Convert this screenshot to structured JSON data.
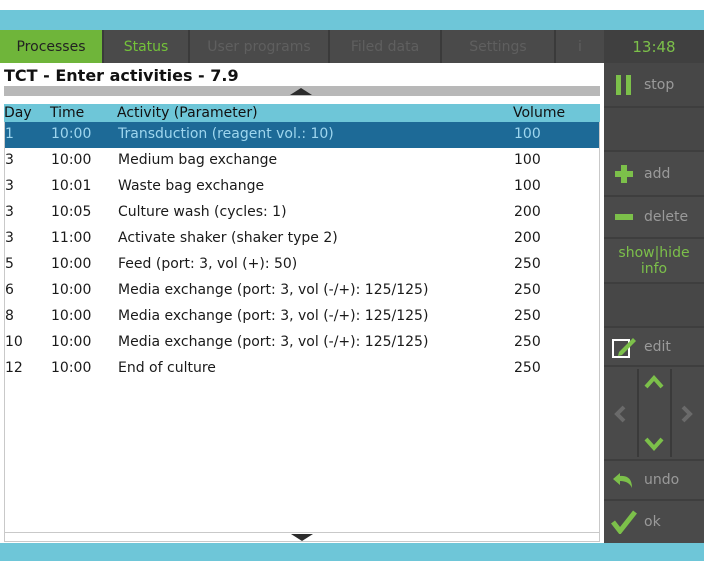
{
  "tabs": [
    {
      "label": "Processes",
      "state": "active"
    },
    {
      "label": "Status",
      "state": "green"
    },
    {
      "label": "User programs",
      "state": "disabled"
    },
    {
      "label": "Filed data",
      "state": "disabled"
    },
    {
      "label": "Settings",
      "state": "disabled"
    },
    {
      "label": "i",
      "state": "disabled"
    }
  ],
  "clock": "13:48",
  "page_title": "TCT - Enter activities - 7.9",
  "table": {
    "headers": {
      "day": "Day",
      "time": "Time",
      "activity": "Activity (Parameter)",
      "volume": "Volume"
    },
    "rows": [
      {
        "day": "1",
        "time": "10:00",
        "activity": "Transduction (reagent vol.: 10)",
        "volume": "100",
        "selected": true
      },
      {
        "day": "3",
        "time": "10:00",
        "activity": "Medium bag exchange",
        "volume": "100"
      },
      {
        "day": "3",
        "time": "10:01",
        "activity": "Waste bag exchange",
        "volume": "100"
      },
      {
        "day": "3",
        "time": "10:05",
        "activity": "Culture wash (cycles: 1)",
        "volume": "200"
      },
      {
        "day": "3",
        "time": "11:00",
        "activity": "Activate shaker (shaker type 2)",
        "volume": "200"
      },
      {
        "day": "5",
        "time": "10:00",
        "activity": "Feed (port: 3, vol (+): 50)",
        "volume": "250"
      },
      {
        "day": "6",
        "time": "10:00",
        "activity": "Media exchange (port: 3, vol (-/+): 125/125)",
        "volume": "250"
      },
      {
        "day": "8",
        "time": "10:00",
        "activity": "Media exchange (port: 3, vol (-/+): 125/125)",
        "volume": "250"
      },
      {
        "day": "10",
        "time": "10:00",
        "activity": "Media exchange (port: 3, vol (-/+): 125/125)",
        "volume": "250"
      },
      {
        "day": "12",
        "time": "10:00",
        "activity": "End of culture",
        "volume": "250"
      }
    ]
  },
  "sidebar": {
    "stop": "stop",
    "add": "add",
    "delete": "delete",
    "show_hide_line1": "show|hide",
    "show_hide_line2": "info",
    "edit": "edit",
    "undo": "undo",
    "ok": "ok"
  },
  "colors": {
    "accent_green": "#74c23a",
    "header_cyan": "#6ec6d8",
    "selected_row": "#1d6a97",
    "dark_panel": "#4a4a4a"
  }
}
